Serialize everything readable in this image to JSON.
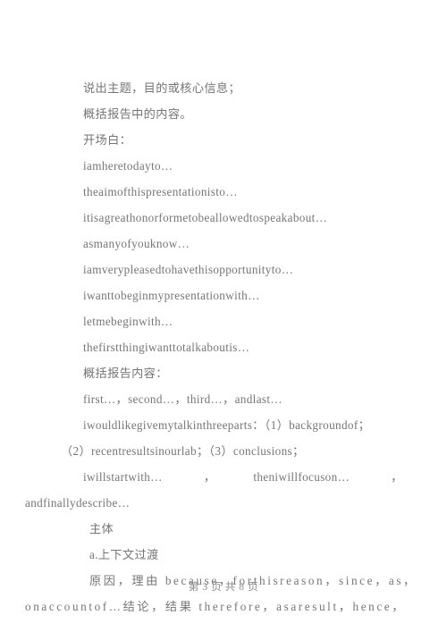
{
  "document": {
    "background_color": "#ffffff",
    "text_color": "#767676",
    "lines": [
      {
        "id": "l1",
        "text": "说出主题，目的或核心信息；"
      },
      {
        "id": "l2",
        "text": "概括报告中的内容。"
      },
      {
        "id": "l3",
        "text": "开场白："
      },
      {
        "id": "l4",
        "text": "iamheretodayto…"
      },
      {
        "id": "l5",
        "text": "theaimofthispresentationisto…"
      },
      {
        "id": "l6",
        "text": "itisagreathonorformetobeallowedtospeakabout…"
      },
      {
        "id": "l7",
        "text": "asmanyofyouknow…"
      },
      {
        "id": "l8",
        "text": "iamverypleasedtohavethisopportunityto…"
      },
      {
        "id": "l9",
        "text": "iwanttobeginmypresentationwith…"
      },
      {
        "id": "l10",
        "text": "letmebeginwith…"
      },
      {
        "id": "l11",
        "text": "thefirstthingiwanttotalkaboutis…"
      },
      {
        "id": "l12",
        "text": "概括报告内容："
      },
      {
        "id": "l13",
        "text": "first…，second…，third…，andlast…"
      },
      {
        "id": "l14",
        "text": "iwouldlikegivemytalkinthreeparts：（1）backgroundof；"
      },
      {
        "id": "l15",
        "text": "（2）recentresultsinourlab；（3）conclusions；"
      },
      {
        "id": "l16a",
        "text": "iwillstartwith…"
      },
      {
        "id": "l16b",
        "text": "，"
      },
      {
        "id": "l16c",
        "text": "theniwillfocuson…"
      },
      {
        "id": "l16d",
        "text": "，"
      },
      {
        "id": "l17",
        "text": "andfinallydescribe…"
      },
      {
        "id": "l18",
        "text": "主体"
      },
      {
        "id": "l19",
        "text": "a.上下文过渡"
      },
      {
        "id": "l20",
        "text": "原因，理由 because，forthisreason，since，as，"
      },
      {
        "id": "l21",
        "text": "onaccountof…结论，结果 therefore，asaresult，hence，"
      }
    ]
  },
  "footer": {
    "page_label": "第 3 页  共 8 页"
  }
}
